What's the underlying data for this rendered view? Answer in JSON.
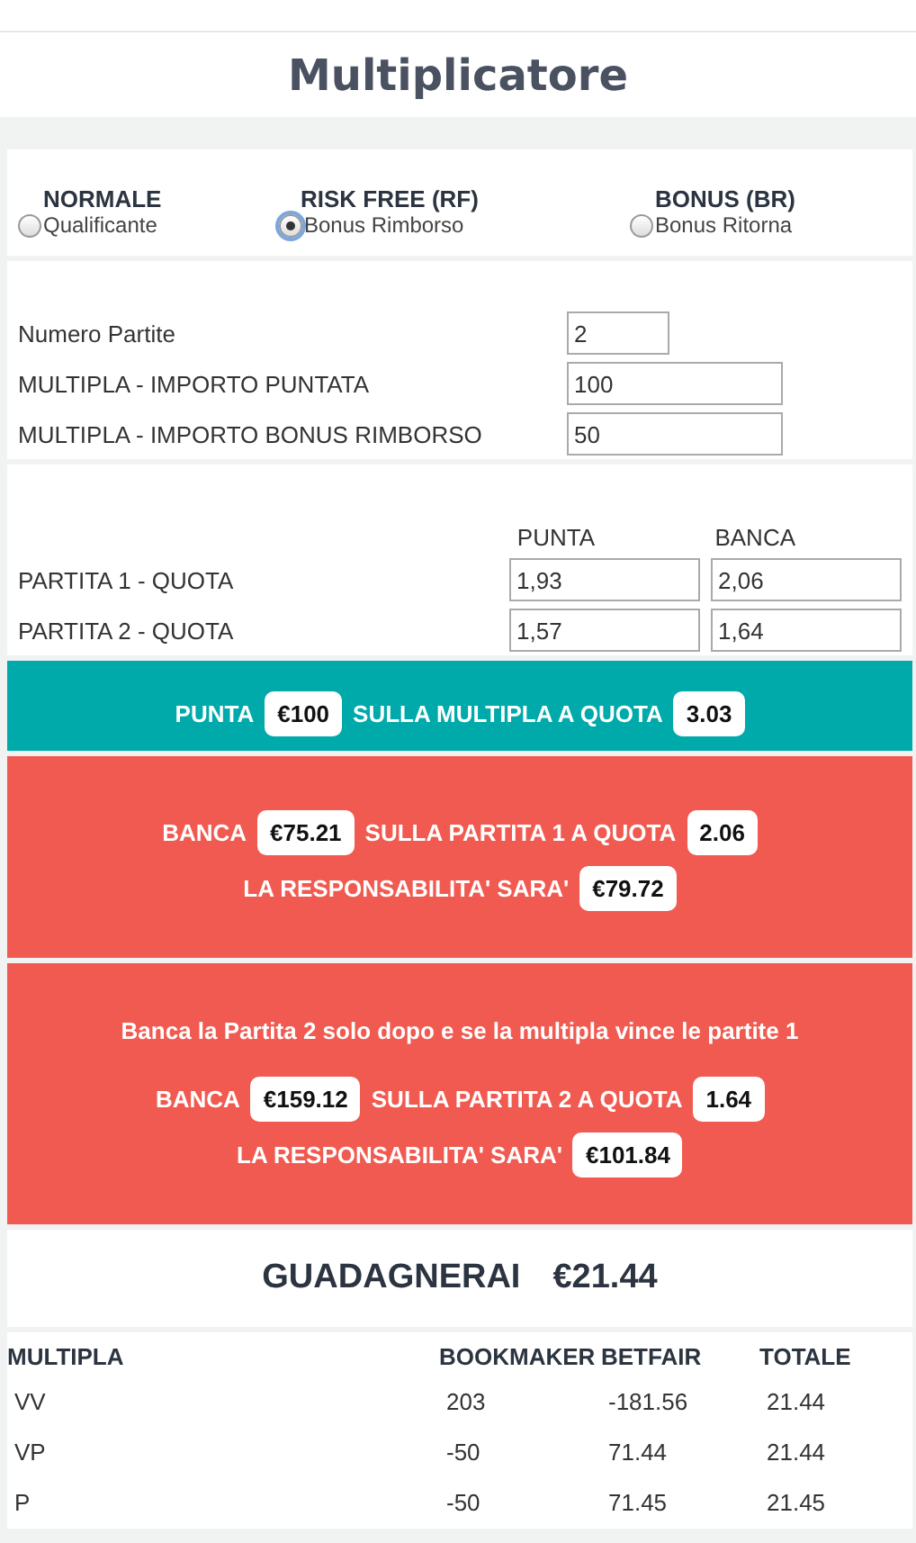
{
  "title": "Multiplicatore",
  "modes": [
    {
      "heading": "NORMALE",
      "label": "Qualificante",
      "selected": false
    },
    {
      "heading": "RISK FREE (RF)",
      "label": "Bonus Rimborso",
      "selected": true
    },
    {
      "heading": "BONUS (BR)",
      "label": "Bonus Ritorna",
      "selected": false
    }
  ],
  "fields": [
    {
      "label": "Numero Partite",
      "value": "2",
      "kind": "short"
    },
    {
      "label": "MULTIPLA - IMPORTO PUNTATA",
      "value": "100",
      "kind": "wide"
    },
    {
      "label": "MULTIPLA - IMPORTO BONUS RIMBORSO",
      "value": "50",
      "kind": "wide"
    }
  ],
  "odds": {
    "columns": [
      "PUNTA",
      "BANCA"
    ],
    "rows": [
      {
        "label": "PARTITA 1 - QUOTA",
        "values": [
          "1,93",
          "2,06"
        ]
      },
      {
        "label": "PARTITA 2 - QUOTA",
        "values": [
          "1,57",
          "1,64"
        ]
      }
    ]
  },
  "panels": [
    {
      "kind": "punta",
      "lines": [
        [
          {
            "kind": "text",
            "text": "PUNTA"
          },
          {
            "kind": "value",
            "text": "€100"
          },
          {
            "kind": "text",
            "text": "SULLA MULTIPLA A QUOTA"
          },
          {
            "kind": "value",
            "text": "3.03"
          }
        ]
      ]
    },
    {
      "kind": "banca",
      "lines": [
        [
          {
            "kind": "text",
            "text": "BANCA"
          },
          {
            "kind": "value",
            "text": "€75.21"
          },
          {
            "kind": "text",
            "text": "SULLA PARTITA 1 A QUOTA"
          },
          {
            "kind": "value",
            "text": "2.06"
          }
        ],
        [
          {
            "kind": "text",
            "text": "LA RESPONSABILITA' SARA'"
          },
          {
            "kind": "value",
            "text": "€79.72"
          }
        ]
      ]
    },
    {
      "kind": "banca",
      "note": "Banca la Partita 2 solo dopo e se la multipla vince le partite 1",
      "lines": [
        [
          {
            "kind": "text",
            "text": "BANCA"
          },
          {
            "kind": "value",
            "text": "€159.12"
          },
          {
            "kind": "text",
            "text": "SULLA PARTITA 2 A QUOTA"
          },
          {
            "kind": "value",
            "text": "1.64"
          }
        ],
        [
          {
            "kind": "text",
            "text": "LA RESPONSABILITA' SARA'"
          },
          {
            "kind": "value",
            "text": "€101.84"
          }
        ]
      ]
    }
  ],
  "result": {
    "label": "GUADAGNERAI",
    "value": "€21.44"
  },
  "table": {
    "columns": [
      "MULTIPLA",
      "BOOKMAKER",
      "BETFAIR",
      "TOTALE"
    ],
    "rows": [
      [
        "VV",
        "203",
        "-181.56",
        "21.44"
      ],
      [
        "VP",
        "-50",
        "71.44",
        "21.44"
      ],
      [
        "P",
        "-50",
        "71.45",
        "21.45"
      ]
    ]
  }
}
